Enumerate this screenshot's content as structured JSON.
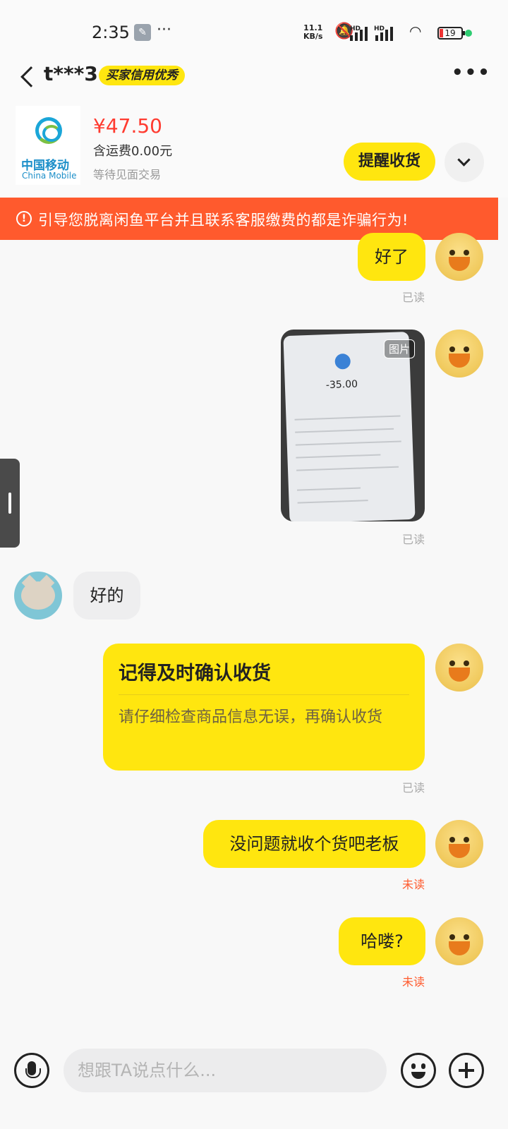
{
  "status_bar": {
    "time": "2:35",
    "tool_icon": "wrench-icon",
    "more_indicator": "···",
    "net_speed_value": "11.1",
    "net_speed_unit": "KB/s",
    "hd_label": "HD",
    "battery": "19"
  },
  "header": {
    "user_name": "t***3",
    "credit_badge": "买家信用优秀"
  },
  "product": {
    "logo_cn": "中国移动",
    "logo_en": "China Mobile",
    "price": "¥47.50",
    "shipping": "含运费0.00元",
    "trade_status": "等待见面交易",
    "remind_label": "提醒收货"
  },
  "warning": {
    "text": "引导您脱离闲鱼平台并且联系客服缴费的都是诈骗行为!"
  },
  "messages": [
    {
      "text": "好了",
      "status": "已读"
    },
    {
      "image_tag": "图片",
      "image_amount": "-35.00",
      "status": "已读"
    },
    {
      "text": "好的"
    },
    {
      "title": "记得及时确认收货",
      "body": "请仔细检查商品信息无误，再确认收货",
      "status": "已读"
    },
    {
      "text": "没问题就收个货吧老板",
      "status": "未读"
    },
    {
      "text": "哈喽?",
      "status": "未读"
    }
  ],
  "input": {
    "placeholder": "想跟TA说点什么..."
  },
  "colors": {
    "accent_yellow": "#ffe60f",
    "warning_orange": "#ff5a2d",
    "price_red": "#ff3b30"
  }
}
